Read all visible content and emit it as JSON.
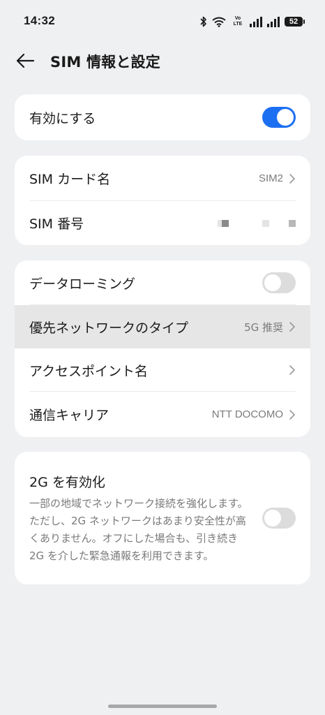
{
  "status_bar": {
    "time": "14:32",
    "volte_top": "Vo",
    "volte_bottom": "LTE",
    "battery": "52"
  },
  "header": {
    "title": "SIM 情報と設定"
  },
  "enable_card": {
    "label": "有効にする",
    "enabled": true
  },
  "sim_card": {
    "name_label": "SIM カード名",
    "name_value": "SIM2",
    "number_label": "SIM 番号"
  },
  "network_card": {
    "roaming_label": "データローミング",
    "roaming_enabled": false,
    "preferred_label": "優先ネットワークのタイプ",
    "preferred_value": "5G 推奨",
    "apn_label": "アクセスポイント名",
    "carrier_label": "通信キャリア",
    "carrier_value": "NTT DOCOMO"
  },
  "enable_2g_card": {
    "title": "2G を有効化",
    "description": "一部の地域でネットワーク接続を強化します。ただし、2G ネットワークはあまり安全性が高くありません。オフにした場合も、引き続き 2G を介した緊急通報を利用できます。",
    "enabled": false
  },
  "colors": {
    "background": "#eff0f2",
    "card": "#ffffff",
    "accent": "#1d6ff2",
    "secondary_text": "#7a7a7a"
  }
}
